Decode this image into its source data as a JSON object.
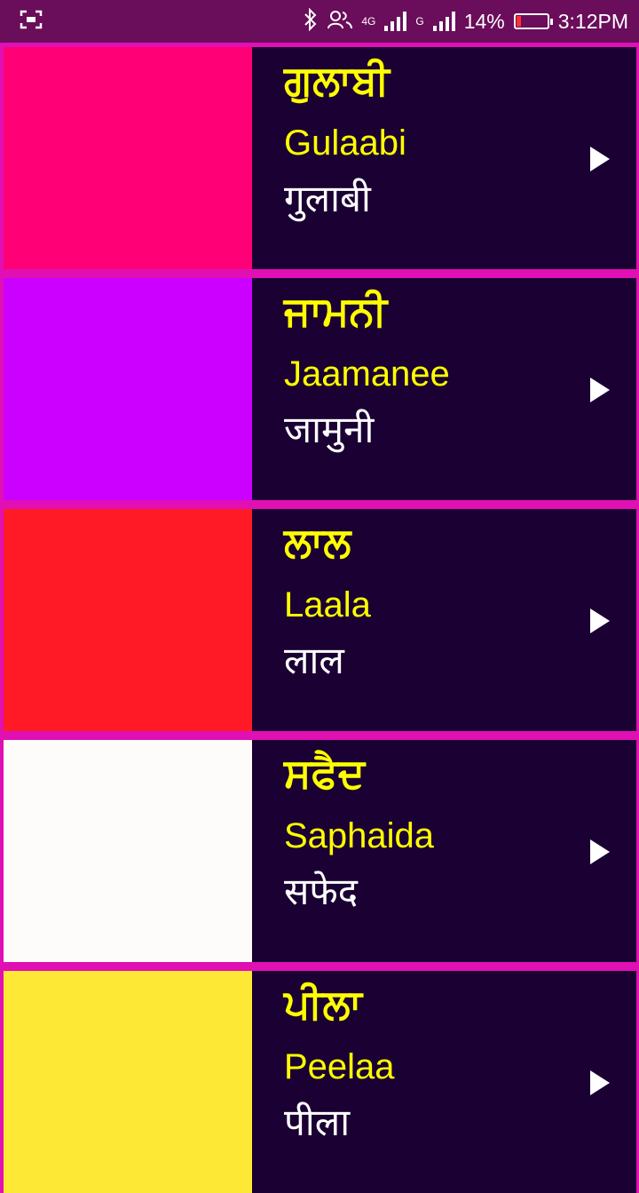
{
  "status_bar": {
    "network_4g": "4G",
    "network_g": "G",
    "battery_percent": "14%",
    "time": "3:12PM",
    "battery_level": 0.14
  },
  "colors": [
    {
      "punjabi": "ਗੁਲਾਬੀ",
      "transliteration": "Gulaabi",
      "hindi": "गुलाबी",
      "swatch": "#ff0077"
    },
    {
      "punjabi": "ਜਾਮਨੀ",
      "transliteration": "Jaamanee",
      "hindi": "जामुनी",
      "swatch": "#cc00ff"
    },
    {
      "punjabi": "ਲਾਲ",
      "transliteration": "Laala",
      "hindi": "लाल",
      "swatch": "#ff1a25"
    },
    {
      "punjabi": "ਸਫੈਦ",
      "transliteration": "Saphaida",
      "hindi": "सफेद",
      "swatch": "#fdfcfa"
    },
    {
      "punjabi": "ਪੀਲਾ",
      "transliteration": "Peelaa",
      "hindi": "पीला",
      "swatch": "#fde935"
    }
  ]
}
